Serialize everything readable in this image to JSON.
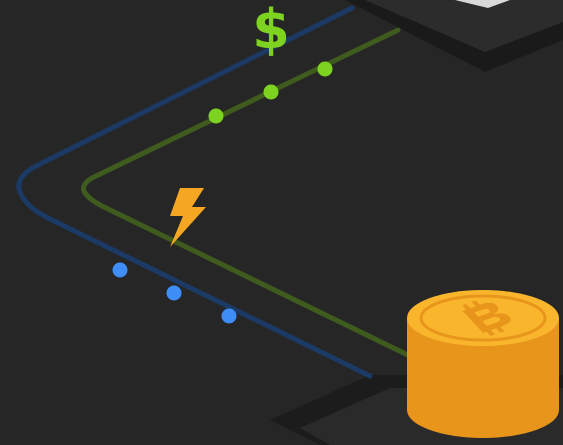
{
  "scene": {
    "background_color": "#262626",
    "blue_line_color": "#1b3a66",
    "green_line_color": "#3f5b1e",
    "blue_dot_color": "#3f8df7",
    "green_dot_color": "#7ed321",
    "bolt_color": "#f5a623",
    "coin_color": "#f5a623",
    "icons": {
      "dollar": "dollar-sign-icon",
      "bolt": "lightning-bolt-icon",
      "coins": "bitcoin-coin-stack-icon"
    },
    "dollar_symbol": "$"
  }
}
